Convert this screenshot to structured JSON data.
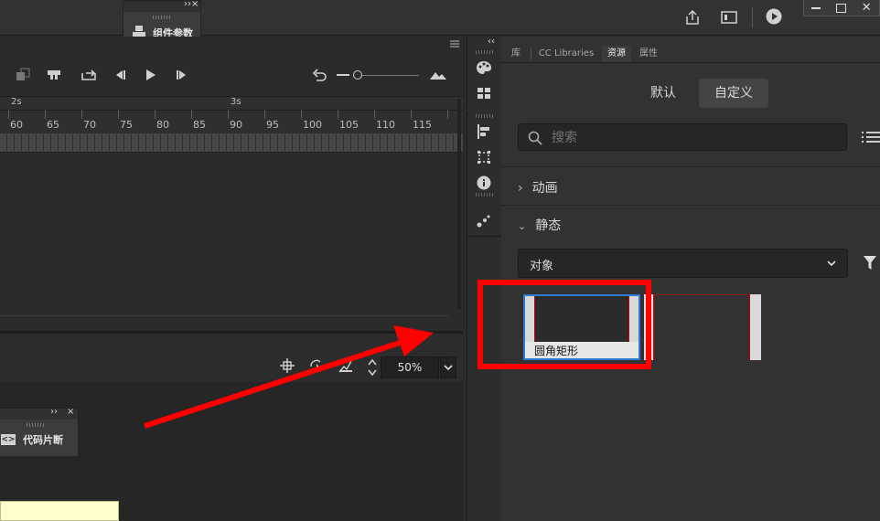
{
  "float_panels": {
    "component_params": {
      "label": "组件参数"
    },
    "code_snippets": {
      "label": "代码片断"
    }
  },
  "timeline": {
    "seconds_marks": [
      "2s",
      "3s"
    ],
    "frame_numbers": [
      "60",
      "65",
      "70",
      "75",
      "80",
      "85",
      "90",
      "95",
      "100",
      "105",
      "110",
      "115"
    ]
  },
  "stage": {
    "zoom": "50%"
  },
  "right_panel": {
    "tabs": [
      "库",
      "CC Libraries",
      "资源",
      "属性"
    ],
    "active_tab": "资源",
    "segmented": {
      "default_label": "默认",
      "custom_label": "自定义"
    },
    "search": {
      "placeholder": "搜索"
    },
    "sections": {
      "animation": "动画",
      "static": "静态"
    },
    "filter_select": {
      "value": "对象"
    },
    "assets": [
      {
        "name": "圆角矩形"
      }
    ]
  },
  "annotation": {
    "color": "#ff0000"
  }
}
